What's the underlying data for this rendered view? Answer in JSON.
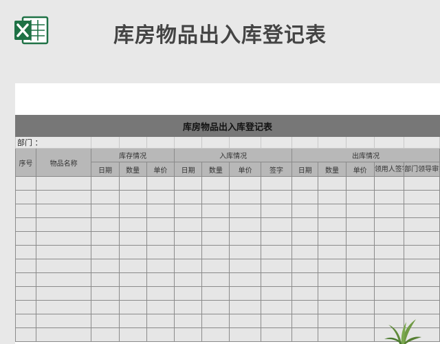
{
  "page": {
    "heading": "库房物品出入库登记表",
    "app_icon": "excel-icon",
    "decoration_icon": "plant-icon"
  },
  "sheet": {
    "title": "库房物品出入库登记表",
    "dept_label": "部门 ：",
    "headers": {
      "seq": "序号",
      "item_name": "物品名称",
      "stock": "库存情况",
      "inbound": "入库情况",
      "outbound": "出库情况"
    },
    "sub_headers": {
      "stock": [
        "日期",
        "数量",
        "单价"
      ],
      "inbound": [
        "日期",
        "数量",
        "单价",
        "签字"
      ],
      "outbound": [
        "日期",
        "数量",
        "单价",
        "领用人签字",
        "部门领导审批"
      ]
    },
    "empty_rows": 12
  },
  "colors": {
    "excel_green": "#1e7145",
    "title_bar": "#777777",
    "header_bg": "#b8b8b8",
    "cell_bg": "#e6e6e6"
  }
}
